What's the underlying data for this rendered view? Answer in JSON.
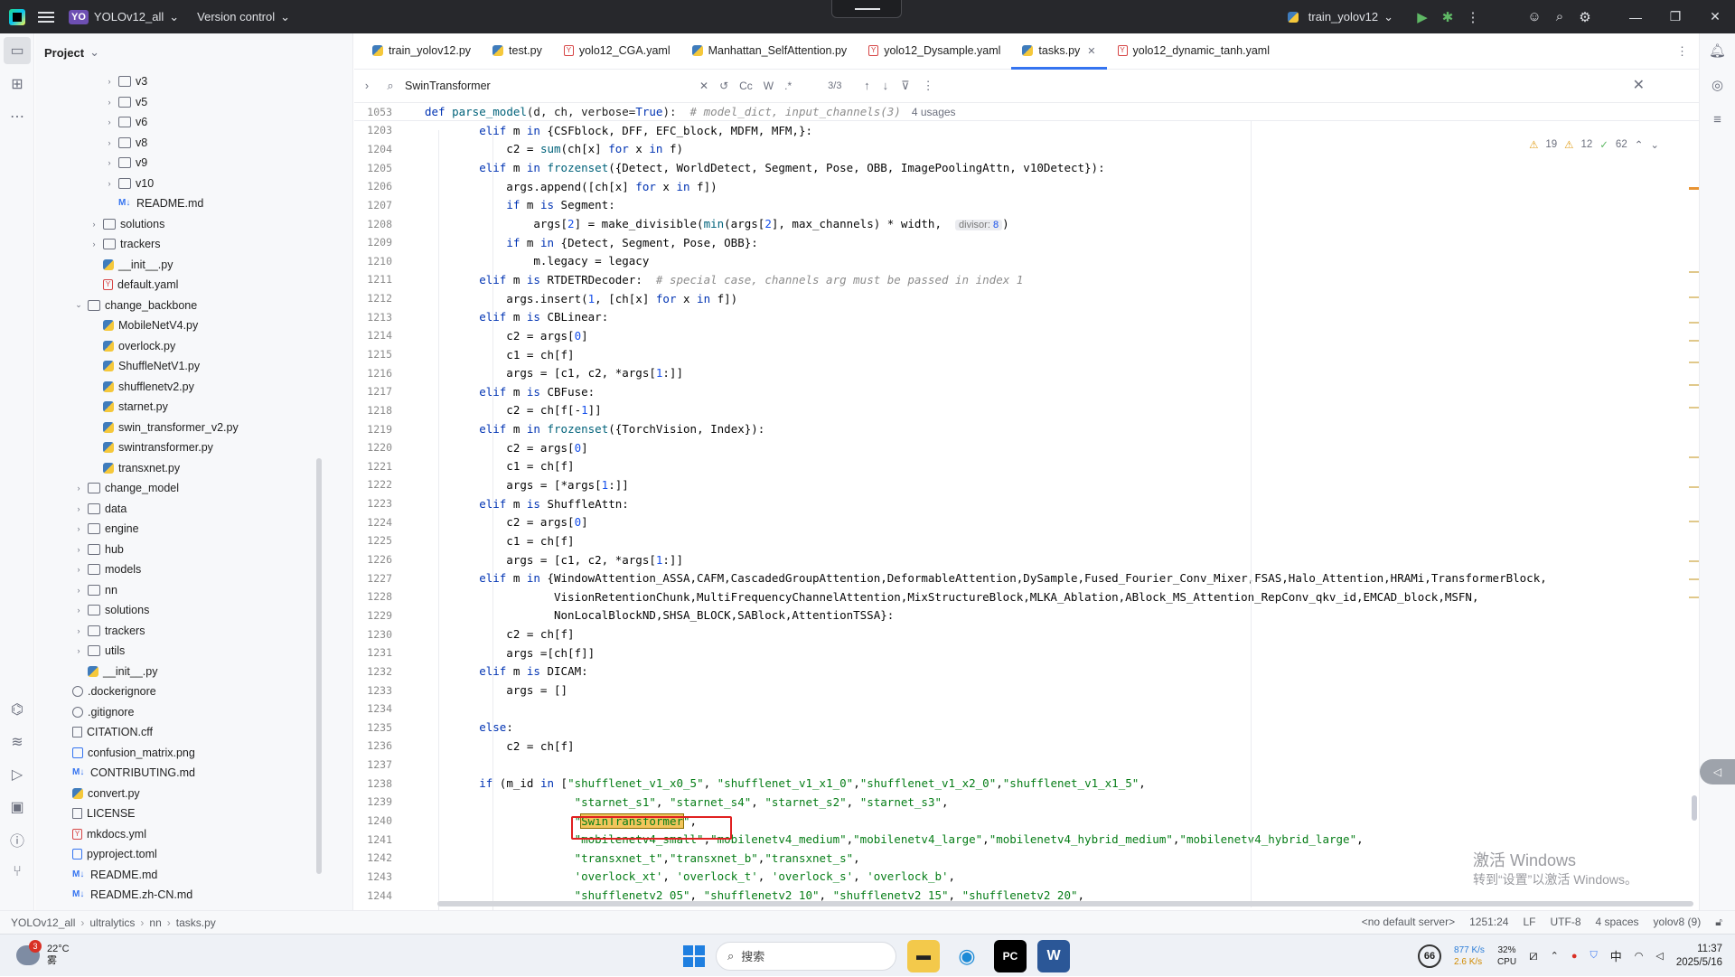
{
  "titlebar": {
    "project_badge": "YO",
    "project_name": "YOLOv12_all",
    "vcs": "Version control",
    "run_config": "train_yolov12"
  },
  "project_panel": {
    "title": "Project",
    "items": [
      {
        "label": "v3",
        "type": "folder",
        "indent": 5,
        "chev": "›"
      },
      {
        "label": "v5",
        "type": "folder",
        "indent": 5,
        "chev": "›"
      },
      {
        "label": "v6",
        "type": "folder",
        "indent": 5,
        "chev": "›"
      },
      {
        "label": "v8",
        "type": "folder",
        "indent": 5,
        "chev": "›"
      },
      {
        "label": "v9",
        "type": "folder",
        "indent": 5,
        "chev": "›"
      },
      {
        "label": "v10",
        "type": "folder",
        "indent": 5,
        "chev": "›"
      },
      {
        "label": "README.md",
        "type": "md",
        "indent": 5,
        "chev": ""
      },
      {
        "label": "solutions",
        "type": "folder",
        "indent": 4,
        "chev": "›"
      },
      {
        "label": "trackers",
        "type": "folder",
        "indent": 4,
        "chev": "›"
      },
      {
        "label": "__init__.py",
        "type": "py",
        "indent": 4,
        "chev": ""
      },
      {
        "label": "default.yaml",
        "type": "yaml",
        "indent": 4,
        "chev": ""
      },
      {
        "label": "change_backbone",
        "type": "folder",
        "indent": 3,
        "chev": "⌄"
      },
      {
        "label": "MobileNetV4.py",
        "type": "py",
        "indent": 4,
        "chev": ""
      },
      {
        "label": "overlock.py",
        "type": "py",
        "indent": 4,
        "chev": ""
      },
      {
        "label": "ShuffleNetV1.py",
        "type": "py",
        "indent": 4,
        "chev": ""
      },
      {
        "label": "shufflenetv2.py",
        "type": "py",
        "indent": 4,
        "chev": ""
      },
      {
        "label": "starnet.py",
        "type": "py",
        "indent": 4,
        "chev": ""
      },
      {
        "label": "swin_transformer_v2.py",
        "type": "py",
        "indent": 4,
        "chev": ""
      },
      {
        "label": "swintransformer.py",
        "type": "py",
        "indent": 4,
        "chev": ""
      },
      {
        "label": "transxnet.py",
        "type": "py",
        "indent": 4,
        "chev": ""
      },
      {
        "label": "change_model",
        "type": "folder",
        "indent": 3,
        "chev": "›"
      },
      {
        "label": "data",
        "type": "folder",
        "indent": 3,
        "chev": "›"
      },
      {
        "label": "engine",
        "type": "folder",
        "indent": 3,
        "chev": "›"
      },
      {
        "label": "hub",
        "type": "folder",
        "indent": 3,
        "chev": "›"
      },
      {
        "label": "models",
        "type": "folder",
        "indent": 3,
        "chev": "›"
      },
      {
        "label": "nn",
        "type": "folder",
        "indent": 3,
        "chev": "›"
      },
      {
        "label": "solutions",
        "type": "folder",
        "indent": 3,
        "chev": "›"
      },
      {
        "label": "trackers",
        "type": "folder",
        "indent": 3,
        "chev": "›"
      },
      {
        "label": "utils",
        "type": "folder",
        "indent": 3,
        "chev": "›"
      },
      {
        "label": "__init__.py",
        "type": "py",
        "indent": 3,
        "chev": ""
      },
      {
        "label": ".dockerignore",
        "type": "ign",
        "indent": 2,
        "chev": ""
      },
      {
        "label": ".gitignore",
        "type": "ign",
        "indent": 2,
        "chev": ""
      },
      {
        "label": "CITATION.cff",
        "type": "txt",
        "indent": 2,
        "chev": ""
      },
      {
        "label": "confusion_matrix.png",
        "type": "img",
        "indent": 2,
        "chev": ""
      },
      {
        "label": "CONTRIBUTING.md",
        "type": "md",
        "indent": 2,
        "chev": ""
      },
      {
        "label": "convert.py",
        "type": "py",
        "indent": 2,
        "chev": ""
      },
      {
        "label": "LICENSE",
        "type": "txt",
        "indent": 2,
        "chev": ""
      },
      {
        "label": "mkdocs.yml",
        "type": "yaml",
        "indent": 2,
        "chev": ""
      },
      {
        "label": "pyproject.toml",
        "type": "toml",
        "indent": 2,
        "chev": ""
      },
      {
        "label": "README.md",
        "type": "md",
        "indent": 2,
        "chev": ""
      },
      {
        "label": "README.zh-CN.md",
        "type": "md",
        "indent": 2,
        "chev": ""
      }
    ]
  },
  "tabs": [
    {
      "label": "train_yolov12.py",
      "type": "py",
      "active": false
    },
    {
      "label": "test.py",
      "type": "py",
      "active": false
    },
    {
      "label": "yolo12_CGA.yaml",
      "type": "yaml",
      "active": false
    },
    {
      "label": "Manhattan_SelfAttention.py",
      "type": "py",
      "active": false
    },
    {
      "label": "yolo12_Dysample.yaml",
      "type": "yaml",
      "active": false
    },
    {
      "label": "tasks.py",
      "type": "py",
      "active": true
    },
    {
      "label": "yolo12_dynamic_tanh.yaml",
      "type": "yaml",
      "active": false
    }
  ],
  "find": {
    "query": "SwinTransformer",
    "case": "Cc",
    "word": "W",
    "regex": ".*",
    "count": "3/3"
  },
  "sticky": {
    "line": "1053",
    "code": "def parse_model(d, ch, verbose=True):",
    "comment": "# model_dict, input_channels(3)",
    "usages": "4 usages"
  },
  "indicators": {
    "warnings": "19",
    "weak": "12",
    "ok": "62"
  },
  "code_lines": [
    {
      "n": "1203",
      "html": "        <span class='kw'>elif</span> m <span class='kw'>in</span> {CSFblock, DFF, EFC_block, MDFM, MFM,}:"
    },
    {
      "n": "1204",
      "html": "            c2 = <span class='fn'>sum</span>(ch[x] <span class='kw'>for</span> x <span class='kw'>in</span> f)"
    },
    {
      "n": "1205",
      "html": "        <span class='kw'>elif</span> m <span class='kw'>in</span> <span class='fn'>frozenset</span>({Detect, WorldDetect, Segment, Pose, OBB, ImagePoolingAttn, v10Detect}):"
    },
    {
      "n": "1206",
      "html": "            args.append([ch[x] <span class='kw'>for</span> x <span class='kw'>in</span> f])"
    },
    {
      "n": "1207",
      "html": "            <span class='kw'>if</span> m <span class='kw'>is</span> Segment:"
    },
    {
      "n": "1208",
      "html": "                args[<span class='num'>2</span>] = make_divisible(<span class='fn'>min</span>(args[<span class='num'>2</span>], max_channels) * width,  <span class='inlay'>divisor: <span class='num'>8</span></span>)"
    },
    {
      "n": "1209",
      "html": "            <span class='kw'>if</span> m <span class='kw'>in</span> {Detect, Segment, Pose, OBB}:"
    },
    {
      "n": "1210",
      "html": "                m.legacy = legacy"
    },
    {
      "n": "1211",
      "html": "        <span class='kw'>elif</span> m <span class='kw'>is</span> RTDETRDecoder:  <span class='cmt'># special case, channels arg must be passed in index 1</span>"
    },
    {
      "n": "1212",
      "html": "            args.insert(<span class='num'>1</span>, [ch[x] <span class='kw'>for</span> x <span class='kw'>in</span> f])"
    },
    {
      "n": "1213",
      "html": "        <span class='kw'>elif</span> m <span class='kw'>is</span> CBLinear:"
    },
    {
      "n": "1214",
      "html": "            c2 = args[<span class='num'>0</span>]"
    },
    {
      "n": "1215",
      "html": "            c1 = ch[f]"
    },
    {
      "n": "1216",
      "html": "            args = [c1, c2, *args[<span class='num'>1</span>:]]"
    },
    {
      "n": "1217",
      "html": "        <span class='kw'>elif</span> m <span class='kw'>is</span> CBFuse:"
    },
    {
      "n": "1218",
      "html": "            c2 = ch[f[-<span class='num'>1</span>]]"
    },
    {
      "n": "1219",
      "html": "        <span class='kw'>elif</span> m <span class='kw'>in</span> <span class='fn'>frozenset</span>({TorchVision, Index}):"
    },
    {
      "n": "1220",
      "html": "            c2 = args[<span class='num'>0</span>]"
    },
    {
      "n": "1221",
      "html": "            c1 = ch[f]"
    },
    {
      "n": "1222",
      "html": "            args = [*args[<span class='num'>1</span>:]]"
    },
    {
      "n": "1223",
      "html": "        <span class='kw'>elif</span> m <span class='kw'>is</span> ShuffleAttn:"
    },
    {
      "n": "1224",
      "html": "            c2 = args[<span class='num'>0</span>]"
    },
    {
      "n": "1225",
      "html": "            c1 = ch[f]"
    },
    {
      "n": "1226",
      "html": "            args = [c1, c2, *args[<span class='num'>1</span>:]]"
    },
    {
      "n": "1227",
      "html": "        <span class='kw'>elif</span> m <span class='kw'>in</span> {WindowAttention_ASSA,CAFM,CascadedGroupAttention,DeformableAttention,DySample,Fused_Fourier_Conv_Mixer,FSAS,Halo_Attention,HRAMi,TransformerBlock,"
    },
    {
      "n": "1228",
      "html": "                   VisionRetentionChunk,MultiFrequencyChannelAttention,MixStructureBlock,MLKA_Ablation,ABlock_MS_Attention_RepConv_qkv_id,EMCAD_block,MSFN,"
    },
    {
      "n": "1229",
      "html": "                   NonLocalBlockND,SHSA_BLOCK,SABlock,AttentionTSSA}:"
    },
    {
      "n": "1230",
      "html": "            c2 = ch[f]"
    },
    {
      "n": "1231",
      "html": "            args =[ch[f]]"
    },
    {
      "n": "1232",
      "html": "        <span class='kw'>elif</span> m <span class='kw'>is</span> DICAM:"
    },
    {
      "n": "1233",
      "html": "            args = []"
    },
    {
      "n": "1234",
      "html": ""
    },
    {
      "n": "1235",
      "html": "        <span class='kw'>else</span>:"
    },
    {
      "n": "1236",
      "html": "            c2 = ch[f]"
    },
    {
      "n": "1237",
      "html": ""
    },
    {
      "n": "1238",
      "html": "        <span class='kw'>if</span> (m_id <span class='kw'>in</span> [<span class='str'>\"shufflenet_v1_x0_5\"</span>, <span class='str'>\"shufflenet_v1_x1_0\"</span>,<span class='str'>\"shufflenet_v1_x2_0\"</span>,<span class='str'>\"shufflenet_v1_x1_5\"</span>,"
    },
    {
      "n": "1239",
      "html": "                      <span class='str'>\"starnet_s1\"</span>, <span class='str'>\"starnet_s4\"</span>, <span class='str'>\"starnet_s2\"</span>, <span class='str'>\"starnet_s3\"</span>,"
    },
    {
      "n": "1240",
      "html": "                      <span class='str'>\"<span class='hl'>SwinTransformer</span>\"</span>,"
    },
    {
      "n": "1241",
      "html": "                      <span class='str'>\"mobilenetv4_small\"</span>,<span class='str'>\"mobilenetv4_medium\"</span>,<span class='str'>\"mobilenetv4_large\"</span>,<span class='str'>\"mobilenetv4_hybrid_medium\"</span>,<span class='str'>\"mobilenetv4_hybrid_large\"</span>,"
    },
    {
      "n": "1242",
      "html": "                      <span class='str'>\"transxnet_t\"</span>,<span class='str'>\"transxnet_b\"</span>,<span class='str'>\"transxnet_s\"</span>,"
    },
    {
      "n": "1243",
      "html": "                      <span class='str'>'overlock_xt'</span>, <span class='str'>'overlock_t'</span>, <span class='str'>'overlock_s'</span>, <span class='str'>'overlock_b'</span>,"
    },
    {
      "n": "1244",
      "html": "                      <span class='str'>\"shufflenetv2_05\"</span>, <span class='str'>\"shufflenetv2_10\"</span>, <span class='str'>\"shufflenetv2_15\"</span>, <span class='str'>\"shufflenetv2_20\"</span>,"
    }
  ],
  "watermark": {
    "line1": "激活 Windows",
    "line2": "转到“设置”以激活 Windows。"
  },
  "statusbar": {
    "crumbs": [
      "YOLOv12_all",
      "ultralytics",
      "nn",
      "tasks.py"
    ],
    "server": "<no default server>",
    "position": "1251:24",
    "line_sep": "LF",
    "encoding": "UTF-8",
    "indent": "4 spaces",
    "interpreter": "yolov8 (9)"
  },
  "taskbar": {
    "weather_temp": "22°C",
    "weather_desc": "雾",
    "weather_badge": "3",
    "search_placeholder": "搜索",
    "battery": "66",
    "net_up": "877 K/s",
    "net_down": "2.6 K/s",
    "cpu_pct": "32%",
    "cpu_label": "CPU",
    "ime": "中",
    "time": "11:37",
    "date": "2025/5/16"
  }
}
